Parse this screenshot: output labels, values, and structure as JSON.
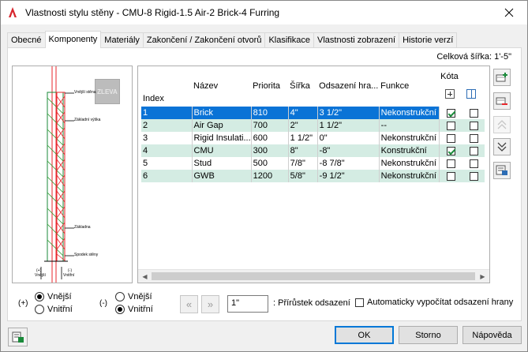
{
  "window": {
    "title": "Vlastnosti stylu stěny - CMU-8 Rigid-1.5 Air-2 Brick-4 Furring"
  },
  "tabs": [
    {
      "label": "Obecné"
    },
    {
      "label": "Komponenty"
    },
    {
      "label": "Materiály"
    },
    {
      "label": "Zakončení / Zakončení otvorů"
    },
    {
      "label": "Klasifikace"
    },
    {
      "label": "Vlastnosti zobrazení"
    },
    {
      "label": "Historie verzí"
    }
  ],
  "active_tab": "Komponenty",
  "total_width": "Celková šířka: 1'-5\"",
  "preview": {
    "button_label": "ZLEVA",
    "labels": {
      "outer_face": "Vnější stěna",
      "baseline_height": "Základní výška",
      "baseline": "Základna",
      "bottom": "Spodek stěny",
      "plus_sign": "(+)",
      "outer_small": "Vnější",
      "minus_sign": "(-)",
      "inner_small": "Vnitřní"
    }
  },
  "grid": {
    "columns": [
      "Index",
      "Název",
      "Priorita",
      "Šířka",
      "Odsazení hra...",
      "Funkce",
      "Kóta"
    ],
    "rows": [
      {
        "index": "1",
        "name": "Brick",
        "priority": "810",
        "width": "4\"",
        "offset": "3 1/2\"",
        "function": "Nekonstrukční",
        "dim1": true,
        "dim2": false
      },
      {
        "index": "2",
        "name": "Air Gap",
        "priority": "700",
        "width": "2\"",
        "offset": "1 1/2\"",
        "function": "--",
        "dim1": false,
        "dim2": false
      },
      {
        "index": "3",
        "name": "Rigid Insulati...",
        "priority": "600",
        "width": "1 1/2\"",
        "offset": "0\"",
        "function": "Nekonstrukční",
        "dim1": false,
        "dim2": false
      },
      {
        "index": "4",
        "name": "CMU",
        "priority": "300",
        "width": "8\"",
        "offset": "-8\"",
        "function": "Konstrukční",
        "dim1": true,
        "dim2": false
      },
      {
        "index": "5",
        "name": "Stud",
        "priority": "500",
        "width": "7/8\"",
        "offset": "-8 7/8\"",
        "function": "Nekonstrukční",
        "dim1": false,
        "dim2": false
      },
      {
        "index": "6",
        "name": "GWB",
        "priority": "1200",
        "width": "5/8\"",
        "offset": "-9 1/2\"",
        "function": "Nekonstrukční",
        "dim1": false,
        "dim2": false
      }
    ]
  },
  "side_buttons": [
    {
      "icon": "add-component-icon",
      "enabled": true
    },
    {
      "icon": "remove-component-icon",
      "enabled": true
    },
    {
      "icon": "move-up-icon",
      "enabled": false
    },
    {
      "icon": "move-down-icon",
      "enabled": true
    },
    {
      "icon": "component-properties-icon",
      "enabled": true
    }
  ],
  "side_plus": {
    "sign": "(+)",
    "options": [
      {
        "label": "Vnější",
        "selected": true
      },
      {
        "label": "Vnitřní",
        "selected": false
      }
    ]
  },
  "side_minus": {
    "sign": "(-)",
    "options": [
      {
        "label": "Vnější",
        "selected": false
      },
      {
        "label": "Vnitřní",
        "selected": true
      }
    ]
  },
  "nav": {
    "prev": "«",
    "next": "»"
  },
  "increment": {
    "value": "1\"",
    "label": ": Přírůstek odsazení"
  },
  "auto_offset": {
    "label": "Automaticky vypočítat odsazení hrany",
    "checked": false
  },
  "buttons": {
    "ok": "OK",
    "cancel": "Storno",
    "help": "Nápověda"
  },
  "colors": {
    "selection": "#0a73d6",
    "alt_row": "#d4ece3",
    "accent_red": "#e8262b"
  }
}
